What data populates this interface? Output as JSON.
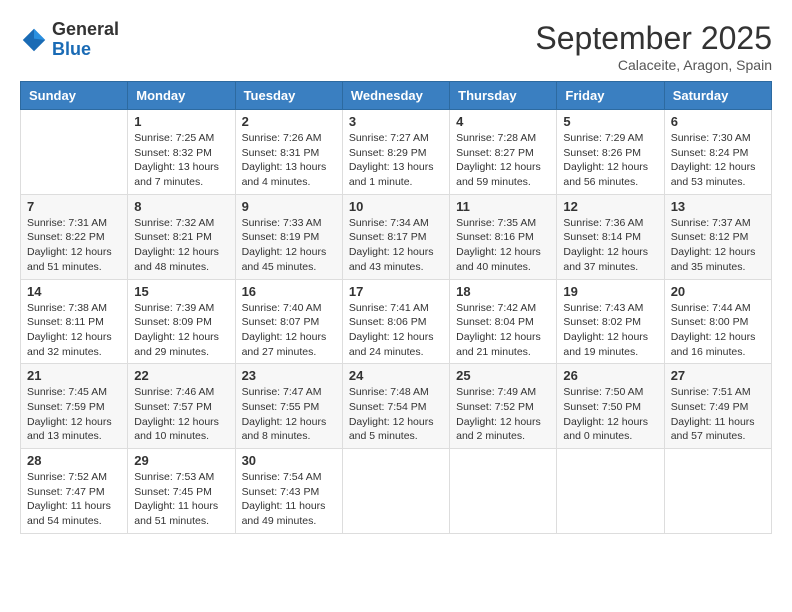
{
  "header": {
    "logo": {
      "line1": "General",
      "line2": "Blue"
    },
    "title": "September 2025",
    "location": "Calaceite, Aragon, Spain"
  },
  "days_of_week": [
    "Sunday",
    "Monday",
    "Tuesday",
    "Wednesday",
    "Thursday",
    "Friday",
    "Saturday"
  ],
  "weeks": [
    [
      {
        "day": "",
        "info": ""
      },
      {
        "day": "1",
        "info": "Sunrise: 7:25 AM\nSunset: 8:32 PM\nDaylight: 13 hours\nand 7 minutes."
      },
      {
        "day": "2",
        "info": "Sunrise: 7:26 AM\nSunset: 8:31 PM\nDaylight: 13 hours\nand 4 minutes."
      },
      {
        "day": "3",
        "info": "Sunrise: 7:27 AM\nSunset: 8:29 PM\nDaylight: 13 hours\nand 1 minute."
      },
      {
        "day": "4",
        "info": "Sunrise: 7:28 AM\nSunset: 8:27 PM\nDaylight: 12 hours\nand 59 minutes."
      },
      {
        "day": "5",
        "info": "Sunrise: 7:29 AM\nSunset: 8:26 PM\nDaylight: 12 hours\nand 56 minutes."
      },
      {
        "day": "6",
        "info": "Sunrise: 7:30 AM\nSunset: 8:24 PM\nDaylight: 12 hours\nand 53 minutes."
      }
    ],
    [
      {
        "day": "7",
        "info": "Sunrise: 7:31 AM\nSunset: 8:22 PM\nDaylight: 12 hours\nand 51 minutes."
      },
      {
        "day": "8",
        "info": "Sunrise: 7:32 AM\nSunset: 8:21 PM\nDaylight: 12 hours\nand 48 minutes."
      },
      {
        "day": "9",
        "info": "Sunrise: 7:33 AM\nSunset: 8:19 PM\nDaylight: 12 hours\nand 45 minutes."
      },
      {
        "day": "10",
        "info": "Sunrise: 7:34 AM\nSunset: 8:17 PM\nDaylight: 12 hours\nand 43 minutes."
      },
      {
        "day": "11",
        "info": "Sunrise: 7:35 AM\nSunset: 8:16 PM\nDaylight: 12 hours\nand 40 minutes."
      },
      {
        "day": "12",
        "info": "Sunrise: 7:36 AM\nSunset: 8:14 PM\nDaylight: 12 hours\nand 37 minutes."
      },
      {
        "day": "13",
        "info": "Sunrise: 7:37 AM\nSunset: 8:12 PM\nDaylight: 12 hours\nand 35 minutes."
      }
    ],
    [
      {
        "day": "14",
        "info": "Sunrise: 7:38 AM\nSunset: 8:11 PM\nDaylight: 12 hours\nand 32 minutes."
      },
      {
        "day": "15",
        "info": "Sunrise: 7:39 AM\nSunset: 8:09 PM\nDaylight: 12 hours\nand 29 minutes."
      },
      {
        "day": "16",
        "info": "Sunrise: 7:40 AM\nSunset: 8:07 PM\nDaylight: 12 hours\nand 27 minutes."
      },
      {
        "day": "17",
        "info": "Sunrise: 7:41 AM\nSunset: 8:06 PM\nDaylight: 12 hours\nand 24 minutes."
      },
      {
        "day": "18",
        "info": "Sunrise: 7:42 AM\nSunset: 8:04 PM\nDaylight: 12 hours\nand 21 minutes."
      },
      {
        "day": "19",
        "info": "Sunrise: 7:43 AM\nSunset: 8:02 PM\nDaylight: 12 hours\nand 19 minutes."
      },
      {
        "day": "20",
        "info": "Sunrise: 7:44 AM\nSunset: 8:00 PM\nDaylight: 12 hours\nand 16 minutes."
      }
    ],
    [
      {
        "day": "21",
        "info": "Sunrise: 7:45 AM\nSunset: 7:59 PM\nDaylight: 12 hours\nand 13 minutes."
      },
      {
        "day": "22",
        "info": "Sunrise: 7:46 AM\nSunset: 7:57 PM\nDaylight: 12 hours\nand 10 minutes."
      },
      {
        "day": "23",
        "info": "Sunrise: 7:47 AM\nSunset: 7:55 PM\nDaylight: 12 hours\nand 8 minutes."
      },
      {
        "day": "24",
        "info": "Sunrise: 7:48 AM\nSunset: 7:54 PM\nDaylight: 12 hours\nand 5 minutes."
      },
      {
        "day": "25",
        "info": "Sunrise: 7:49 AM\nSunset: 7:52 PM\nDaylight: 12 hours\nand 2 minutes."
      },
      {
        "day": "26",
        "info": "Sunrise: 7:50 AM\nSunset: 7:50 PM\nDaylight: 12 hours\nand 0 minutes."
      },
      {
        "day": "27",
        "info": "Sunrise: 7:51 AM\nSunset: 7:49 PM\nDaylight: 11 hours\nand 57 minutes."
      }
    ],
    [
      {
        "day": "28",
        "info": "Sunrise: 7:52 AM\nSunset: 7:47 PM\nDaylight: 11 hours\nand 54 minutes."
      },
      {
        "day": "29",
        "info": "Sunrise: 7:53 AM\nSunset: 7:45 PM\nDaylight: 11 hours\nand 51 minutes."
      },
      {
        "day": "30",
        "info": "Sunrise: 7:54 AM\nSunset: 7:43 PM\nDaylight: 11 hours\nand 49 minutes."
      },
      {
        "day": "",
        "info": ""
      },
      {
        "day": "",
        "info": ""
      },
      {
        "day": "",
        "info": ""
      },
      {
        "day": "",
        "info": ""
      }
    ]
  ]
}
